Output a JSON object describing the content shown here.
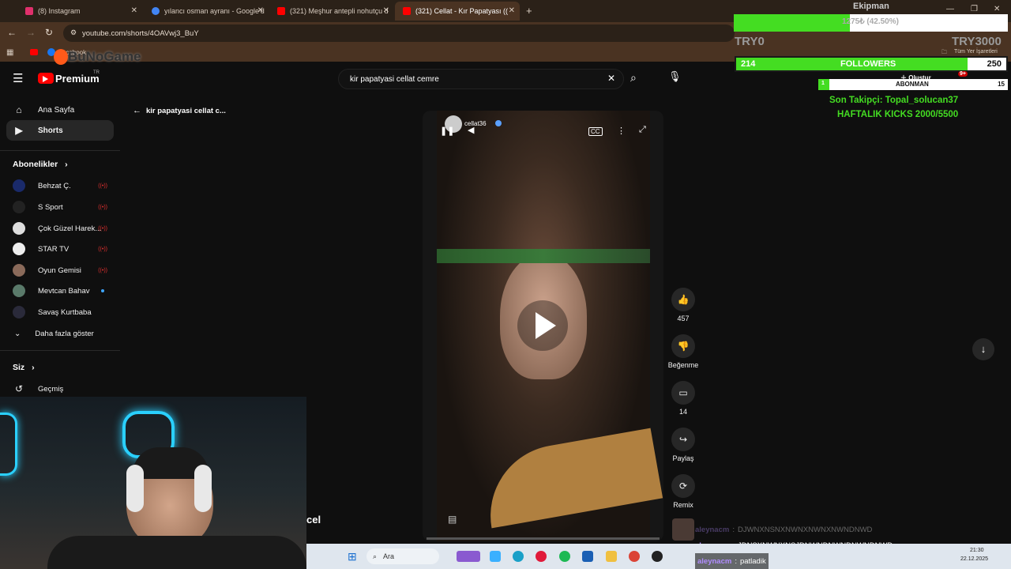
{
  "browser": {
    "tabs": [
      {
        "label": "(8) Instagram",
        "color": "#e1306c",
        "active": false
      },
      {
        "label": "yılancı osman ayranı - Google'd",
        "color": "#4285f4",
        "active": false
      },
      {
        "label": "(321) Meşhur antepli nohutçu d",
        "color": "#ff0000",
        "active": false
      },
      {
        "label": "(321) Cellat - Kır Papatyası ((",
        "color": "#ff0000",
        "active": true
      }
    ],
    "url": "youtube.com/shorts/4OAVwj3_BuY",
    "bookmark": "Facebook",
    "bookmark_right": "Tüm Yer İşaretleri"
  },
  "youtube": {
    "logo": "Premium",
    "region": "TR",
    "search_value": "kir papatyasi cellat cemre",
    "back_title": "kir papatyasi cellat c...",
    "nav": [
      {
        "label": "Ana Sayfa",
        "icon": "home-icon",
        "active": false
      },
      {
        "label": "Shorts",
        "icon": "shorts-icon",
        "active": true
      }
    ],
    "subscriptions_header": "Abonelikler",
    "subscriptions": [
      {
        "name": "Behzat Ç.",
        "live": true
      },
      {
        "name": "S Sport",
        "live": true
      },
      {
        "name": "Çok Güzel Harek...",
        "live": true
      },
      {
        "name": "STAR TV",
        "live": true
      },
      {
        "name": "Oyun Gemisi",
        "live": true
      },
      {
        "name": "Mevtcan Bahav",
        "live": false,
        "new": true
      },
      {
        "name": "Savaş Kurtbaba",
        "live": false
      }
    ],
    "show_more": "Daha fazla göster",
    "you_header": "Siz",
    "history": "Geçmiş",
    "channel": "cellat36",
    "actions": {
      "likes": "457",
      "dislike_label": "Beğenme",
      "comments": "14",
      "share_label": "Paylaş",
      "remix_label": "Remix"
    },
    "create_label": "Oluştur",
    "notif_badge": "9+"
  },
  "overlay": {
    "equipment_title": "Ekipman",
    "progress_text": "1275₺ (42.50%)",
    "progress": 0.425,
    "try_left": "TRY0",
    "try_right": "TRY3000",
    "followers_current": "214",
    "followers_label": "FOLLOWERS",
    "followers_goal": "250",
    "followers_progress": 0.856,
    "subs_label": "ABONMAN",
    "subs_left": "1",
    "subs_right": "15",
    "last_follower": "Son Takipçi: Topal_solucan37",
    "weekly_kicks": "HAFTALIK KICKS 2000/5500",
    "brand": "BuNoGame",
    "cam_text": "cel"
  },
  "chat": [
    {
      "user": "aleynacm",
      "msg": "DJWNXNSNXNWNXNWNXNWNDNWD"
    },
    {
      "user": "aleynacm",
      "msg": "JDNSXNWNXNSJDNWNDNWNDNWNDNWD"
    },
    {
      "user": "aleynacm",
      "msg": "patladik"
    }
  ],
  "taskbar": {
    "search": "Ara",
    "time": "21:30",
    "date": "22.12.2025"
  },
  "colors": {
    "chrome_dark": "#2b2118",
    "chrome_tab": "#4a3322",
    "overlay_green": "#44dd22",
    "chat_user": "#b08cff"
  }
}
